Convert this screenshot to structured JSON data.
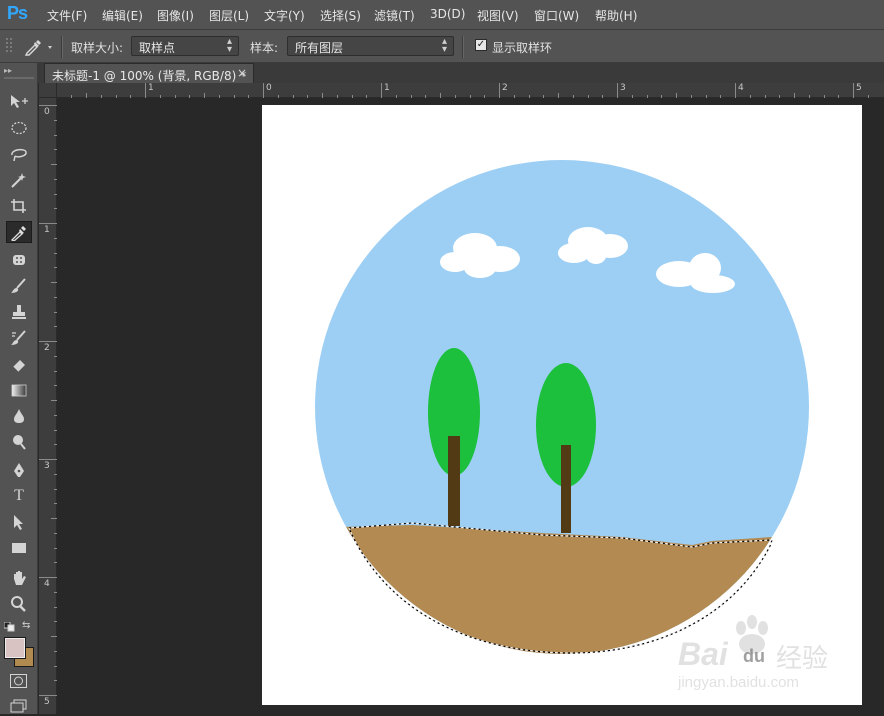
{
  "app": {
    "logo": "Ps"
  },
  "menu": [
    "文件(F)",
    "编辑(E)",
    "图像(I)",
    "图层(L)",
    "文字(Y)",
    "选择(S)",
    "滤镜(T)",
    "3D(D)",
    "视图(V)",
    "窗口(W)",
    "帮助(H)"
  ],
  "options": {
    "sample_size_label": "取样大小:",
    "sample_size_value": "取样点",
    "sample_label": "样本:",
    "sample_value": "所有图层",
    "show_ring_label": "显示取样环",
    "show_ring_checked": true
  },
  "document": {
    "tab_title": "未标题-1 @ 100% (背景, RGB/8) *",
    "close": "×"
  },
  "rulers": {
    "horizontal": [
      "1",
      "0",
      "1",
      "2",
      "3",
      "4",
      "5"
    ],
    "vertical": [
      "0",
      "1",
      "2",
      "3",
      "4",
      "5"
    ]
  },
  "colors": {
    "foreground": "#d8c2c2",
    "background": "#b08a4e",
    "sky": "#9dcff4",
    "ground": "#b38a52",
    "foliage": "#1cc03c",
    "trunk": "#523b14"
  },
  "tools": [
    "move-tool",
    "marquee-tool",
    "lasso-tool",
    "magic-wand-tool",
    "crop-tool",
    "eyedropper-tool",
    "healing-brush-tool",
    "brush-tool",
    "clone-stamp-tool",
    "history-brush-tool",
    "eraser-tool",
    "gradient-tool",
    "blur-tool",
    "dodge-tool",
    "pen-tool",
    "type-tool",
    "path-selection-tool",
    "rectangle-tool",
    "hand-tool",
    "zoom-tool"
  ],
  "watermark": {
    "brand": "Bai",
    "paw": "du",
    "cn": "经验",
    "url": "jingyan.baidu.com"
  }
}
